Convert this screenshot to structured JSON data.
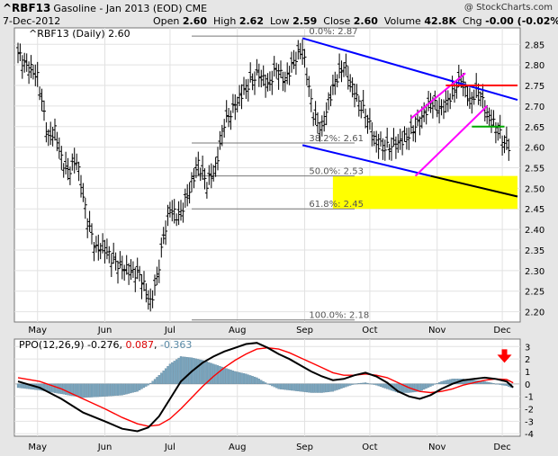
{
  "header": {
    "symbol": "^RBF13",
    "description": "Gasoline - Jan 2013 (EOD) CME",
    "credit": "@ StockCharts.com",
    "date": "7-Dec-2012",
    "quote": {
      "open_label": "Open",
      "open": "2.60",
      "high_label": "High",
      "high": "2.62",
      "low_label": "Low",
      "low": "2.59",
      "close_label": "Close",
      "close": "2.60",
      "volume_label": "Volume",
      "volume": "42.8K",
      "chg_label": "Chg",
      "chg": "-0.00 (-0.02%)"
    }
  },
  "colors": {
    "price_bars": "#000000",
    "channel": "#0000ff",
    "wedge": "#ff00ff",
    "resistance": "#ff0000",
    "support": "#00aa00",
    "projection": "#000000",
    "fib_zone": "#ffff00",
    "ppo_line": "#000000",
    "signal_line": "#ff0000",
    "histogram": "#7aa6bf",
    "arrow": "#ff0000"
  },
  "chart_data": [
    {
      "type": "ohlc",
      "legend": "^RBF13 (Daily) 2.60",
      "x_tick_labels": [
        "May",
        "Jun",
        "Jul",
        "Aug",
        "Sep",
        "Oct",
        "Nov",
        "Dec"
      ],
      "x_tick_day": [
        9,
        40,
        70,
        101,
        132,
        162,
        193,
        223
      ],
      "y_ticks": [
        2.2,
        2.25,
        2.3,
        2.35,
        2.4,
        2.45,
        2.5,
        2.55,
        2.6,
        2.65,
        2.7,
        2.75,
        2.8,
        2.85
      ],
      "ylim": [
        2.175,
        2.89
      ],
      "grid": true,
      "series": [
        {
          "x": [
            0,
            3,
            6,
            9,
            14,
            17,
            20,
            23,
            27,
            32,
            36,
            39,
            43,
            47,
            51,
            56,
            61,
            64,
            67,
            70,
            74,
            78,
            83,
            87,
            91,
            95,
            99,
            103,
            107,
            111,
            115,
            119,
            123,
            127,
            131,
            136,
            140,
            143,
            146,
            150,
            155,
            160,
            165,
            170,
            175,
            180,
            186,
            190,
            195,
            200,
            204,
            208,
            212,
            216,
            220,
            224,
            227
          ],
          "y": [
            2.83,
            2.8,
            2.79,
            2.77,
            2.62,
            2.64,
            2.57,
            2.54,
            2.57,
            2.42,
            2.35,
            2.36,
            2.33,
            2.31,
            2.3,
            2.29,
            2.22,
            2.28,
            2.38,
            2.45,
            2.43,
            2.48,
            2.56,
            2.51,
            2.55,
            2.66,
            2.69,
            2.73,
            2.76,
            2.78,
            2.75,
            2.79,
            2.76,
            2.81,
            2.84,
            2.68,
            2.64,
            2.71,
            2.76,
            2.8,
            2.73,
            2.68,
            2.61,
            2.6,
            2.61,
            2.63,
            2.67,
            2.71,
            2.69,
            2.73,
            2.77,
            2.71,
            2.74,
            2.68,
            2.65,
            2.61,
            2.6
          ]
        }
      ],
      "annotations": [
        {
          "type": "fib_level",
          "label": "0.0%: 2.87",
          "value": 2.87
        },
        {
          "type": "fib_level",
          "label": "38.2%: 2.61",
          "value": 2.61
        },
        {
          "type": "fib_level",
          "label": "50.0%: 2.53",
          "value": 2.53
        },
        {
          "type": "fib_level",
          "label": "61.8%: 2.45",
          "value": 2.45
        },
        {
          "type": "fib_level",
          "label": "100.0%: 2.18",
          "value": 2.18
        },
        {
          "type": "zone",
          "name": "fib-zone",
          "x": [
            145,
            230
          ],
          "y": [
            2.45,
            2.53
          ]
        },
        {
          "type": "trendline",
          "name": "channel-upper",
          "x": [
            131,
            230
          ],
          "y": [
            2.865,
            2.715
          ]
        },
        {
          "type": "trendline",
          "name": "channel-lower",
          "x": [
            131,
            190
          ],
          "y": [
            2.605,
            2.53
          ]
        },
        {
          "type": "trendline",
          "name": "projection-line",
          "x": [
            190,
            230
          ],
          "y": [
            2.53,
            2.48
          ]
        },
        {
          "type": "trendline",
          "name": "wedge-upper",
          "x": [
            181,
            206
          ],
          "y": [
            2.67,
            2.78
          ]
        },
        {
          "type": "trendline",
          "name": "wedge-lower",
          "x": [
            183,
            216
          ],
          "y": [
            2.53,
            2.7
          ]
        },
        {
          "type": "trendline",
          "name": "resistance-line",
          "x": [
            197,
            230
          ],
          "y": [
            2.75,
            2.75
          ]
        },
        {
          "type": "trendline",
          "name": "support-line",
          "x": [
            209,
            224
          ],
          "y": [
            2.65,
            2.65
          ]
        }
      ]
    },
    {
      "type": "line",
      "legend": {
        "prefix": "PPO(12,26,9)",
        "ppo": "-0.276",
        "signal": "0.087",
        "histogram": "-0.363"
      },
      "x_tick_labels": [
        "May",
        "Jun",
        "Jul",
        "Aug",
        "Sep",
        "Oct",
        "Nov",
        "Dec"
      ],
      "y_ticks": [
        -4,
        -3,
        -2,
        -1,
        0,
        1,
        2,
        3
      ],
      "ylim": [
        -4.2,
        3.6
      ],
      "grid": true,
      "series": [
        {
          "name": "PPO",
          "x": [
            0,
            10,
            20,
            30,
            40,
            48,
            55,
            60,
            65,
            70,
            75,
            80,
            85,
            90,
            95,
            100,
            105,
            110,
            115,
            120,
            125,
            130,
            135,
            140,
            145,
            150,
            155,
            160,
            165,
            170,
            175,
            180,
            185,
            190,
            195,
            200,
            205,
            210,
            215,
            220,
            225,
            228
          ],
          "y": [
            0.2,
            -0.3,
            -1.2,
            -2.3,
            -3.0,
            -3.6,
            -3.8,
            -3.5,
            -2.6,
            -1.2,
            0.2,
            1.0,
            1.7,
            2.2,
            2.6,
            2.9,
            3.2,
            3.3,
            2.9,
            2.4,
            2.0,
            1.5,
            1.0,
            0.6,
            0.3,
            0.4,
            0.7,
            0.9,
            0.6,
            0.1,
            -0.6,
            -1.0,
            -1.2,
            -0.9,
            -0.4,
            0.0,
            0.3,
            0.4,
            0.5,
            0.4,
            0.2,
            -0.28
          ]
        },
        {
          "name": "Signal",
          "x": [
            0,
            10,
            20,
            30,
            40,
            48,
            55,
            60,
            65,
            70,
            75,
            80,
            85,
            90,
            95,
            100,
            105,
            110,
            115,
            120,
            125,
            130,
            135,
            140,
            145,
            150,
            155,
            160,
            165,
            170,
            175,
            180,
            185,
            190,
            195,
            200,
            205,
            210,
            215,
            220,
            225,
            228
          ],
          "y": [
            0.5,
            0.2,
            -0.4,
            -1.2,
            -2.0,
            -2.7,
            -3.2,
            -3.4,
            -3.3,
            -2.8,
            -2.0,
            -1.1,
            -0.2,
            0.6,
            1.3,
            1.9,
            2.4,
            2.8,
            2.9,
            2.8,
            2.5,
            2.1,
            1.7,
            1.3,
            0.9,
            0.7,
            0.7,
            0.8,
            0.7,
            0.5,
            0.1,
            -0.3,
            -0.6,
            -0.7,
            -0.6,
            -0.4,
            -0.1,
            0.1,
            0.3,
            0.4,
            0.35,
            0.09
          ]
        },
        {
          "name": "Histogram",
          "x": [
            0,
            10,
            20,
            30,
            40,
            48,
            55,
            60,
            65,
            70,
            75,
            80,
            85,
            90,
            95,
            100,
            105,
            110,
            115,
            120,
            125,
            130,
            135,
            140,
            145,
            150,
            155,
            160,
            165,
            170,
            175,
            180,
            185,
            190,
            195,
            200,
            205,
            210,
            215,
            220,
            225,
            228
          ],
          "y": [
            -0.3,
            -0.5,
            -0.8,
            -1.1,
            -1.0,
            -0.9,
            -0.6,
            -0.1,
            0.7,
            1.6,
            2.2,
            2.1,
            1.9,
            1.6,
            1.3,
            1.0,
            0.8,
            0.5,
            0.0,
            -0.4,
            -0.5,
            -0.6,
            -0.7,
            -0.7,
            -0.6,
            -0.3,
            0.0,
            0.1,
            -0.1,
            -0.4,
            -0.7,
            -0.7,
            -0.6,
            -0.2,
            0.2,
            0.4,
            0.4,
            0.3,
            0.2,
            0.0,
            -0.15,
            -0.36
          ]
        }
      ],
      "annotations": [
        {
          "type": "arrow",
          "direction": "down",
          "x": 224,
          "y": 2.2
        }
      ]
    }
  ]
}
